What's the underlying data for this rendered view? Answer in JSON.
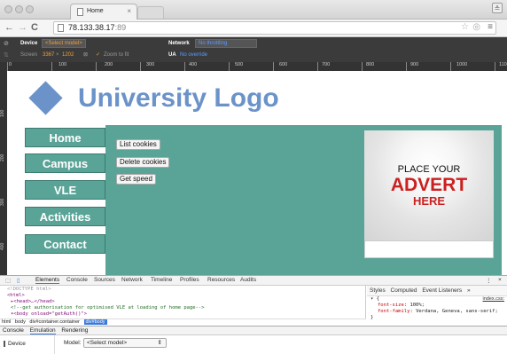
{
  "browser": {
    "tab_title": "Home",
    "url": "78.133.38.17",
    "url_port": ":89",
    "close_glyph": "×"
  },
  "device_bar": {
    "device_label": "Device",
    "device_select": "<Select model>",
    "screen_label": "Screen",
    "screen_width": "3367",
    "screen_x": "×",
    "screen_height": "1202",
    "zoom_to_fit": "Zoom to fit",
    "network_label": "Network",
    "network_select": "No throttling",
    "ua_label": "UA",
    "ua_value": "No override"
  },
  "ruler": {
    "h_labels": [
      "0",
      "100",
      "200",
      "300",
      "400",
      "500",
      "600",
      "700",
      "800",
      "900",
      "1000",
      "110"
    ],
    "v_labels": [
      "100",
      "200",
      "300",
      "400"
    ]
  },
  "page": {
    "logo_text": "University Logo",
    "menu": [
      "Home",
      "Campus",
      "VLE",
      "Activities",
      "Contact"
    ],
    "buttons": [
      "List cookies",
      "Delete cookies",
      "Get speed"
    ],
    "advert": {
      "line1": "PLACE YOUR",
      "line2": "ADVERT",
      "line3": "HERE"
    },
    "colors": {
      "logo": "#6b93c9",
      "menu_bg": "#5aa397",
      "advert_red": "#cc2020"
    }
  },
  "devtools": {
    "tabs": [
      "Elements",
      "Console",
      "Sources",
      "Network",
      "Timeline",
      "Profiles",
      "Resources",
      "Audits"
    ],
    "active_tab": "Elements",
    "elements_lines": [
      "<!DOCTYPE html>",
      "<html>",
      "▸<head>…</head>",
      "<!--get authorisation for optimised VLE at loading of home page-->",
      "▾<body onload=\"getAuth()\">"
    ],
    "breadcrumbs": [
      "html",
      "body",
      "div#container.container",
      "div#body"
    ],
    "styles_tabs": [
      "Styles",
      "Computed",
      "Event Listeners",
      "»"
    ],
    "styles": {
      "selector": "▾ {",
      "source": "index.css:",
      "props": [
        {
          "name": "font-size",
          "value": "100%;"
        },
        {
          "name": "font-family",
          "value": "Verdana, Geneva, sans-serif;"
        }
      ],
      "close": "}"
    },
    "drawer_tabs": [
      "Console",
      "Emulation",
      "Rendering"
    ],
    "drawer_active": "Emulation",
    "drawer_side_item": "Device",
    "model_label": "Model:",
    "model_select": "<Select model>"
  }
}
